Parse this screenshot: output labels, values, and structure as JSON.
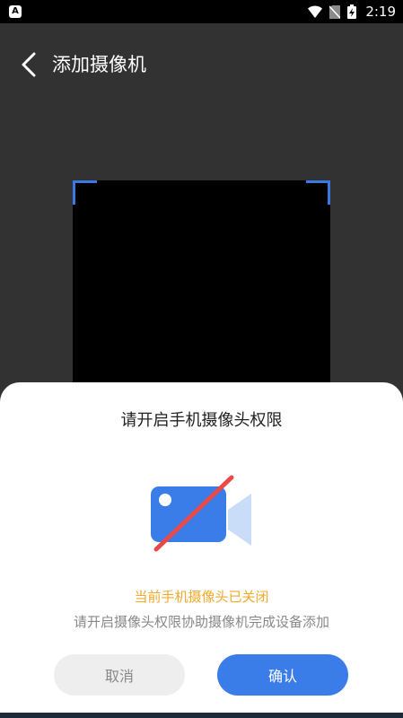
{
  "status_bar": {
    "time": "2:19",
    "notification_icon": "a-letter-icon",
    "icons": [
      "wifi-icon",
      "no-sim-icon",
      "battery-charging-icon"
    ]
  },
  "header": {
    "title": "添加摄像机",
    "back_icon": "chevron-left-icon"
  },
  "scanner": {
    "frame_color": "#3a78e3"
  },
  "dialog": {
    "title": "请开启手机摄像头权限",
    "icon": "camera-off-icon",
    "status_message": "当前手机摄像头已关闭",
    "hint": "请开启摄像头权限协助摄像机完成设备添加",
    "cancel_label": "取消",
    "confirm_label": "确认"
  },
  "colors": {
    "accent": "#3b7de8",
    "warning": "#f1a92b",
    "slash": "#e84a4a"
  }
}
